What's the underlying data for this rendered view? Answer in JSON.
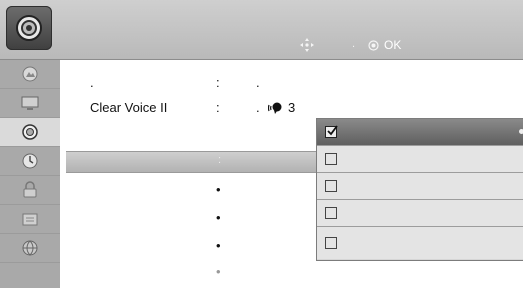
{
  "header": {
    "hint_dot": ".",
    "ok_label": "OK"
  },
  "sidebar": {
    "items": [
      {
        "icon": "picture-icon"
      },
      {
        "icon": "screen-icon"
      },
      {
        "icon": "audio-icon",
        "active": true
      },
      {
        "icon": "clock-icon"
      },
      {
        "icon": "lock-icon"
      },
      {
        "icon": "option-icon"
      },
      {
        "icon": "network-icon"
      }
    ]
  },
  "rows": [
    {
      "label": ".",
      "sep": ":",
      "value": "."
    },
    {
      "label": "Clear Voice II",
      "sep": ":",
      "value_prefix": ".",
      "value_level": "3"
    }
  ],
  "highlight": {
    "sep": ":"
  },
  "bullets": [
    "•",
    "•",
    "•",
    "•"
  ],
  "dropdown": {
    "options": [
      {
        "checked": true
      },
      {
        "checked": false
      },
      {
        "checked": false
      },
      {
        "checked": false
      },
      {
        "checked": false
      }
    ]
  },
  "colors": {
    "header": "#c6c6c6",
    "sidebar": "#a9a9a9",
    "selected_option": "#6f6f6f",
    "highlight_row": "#bfbfbf"
  }
}
